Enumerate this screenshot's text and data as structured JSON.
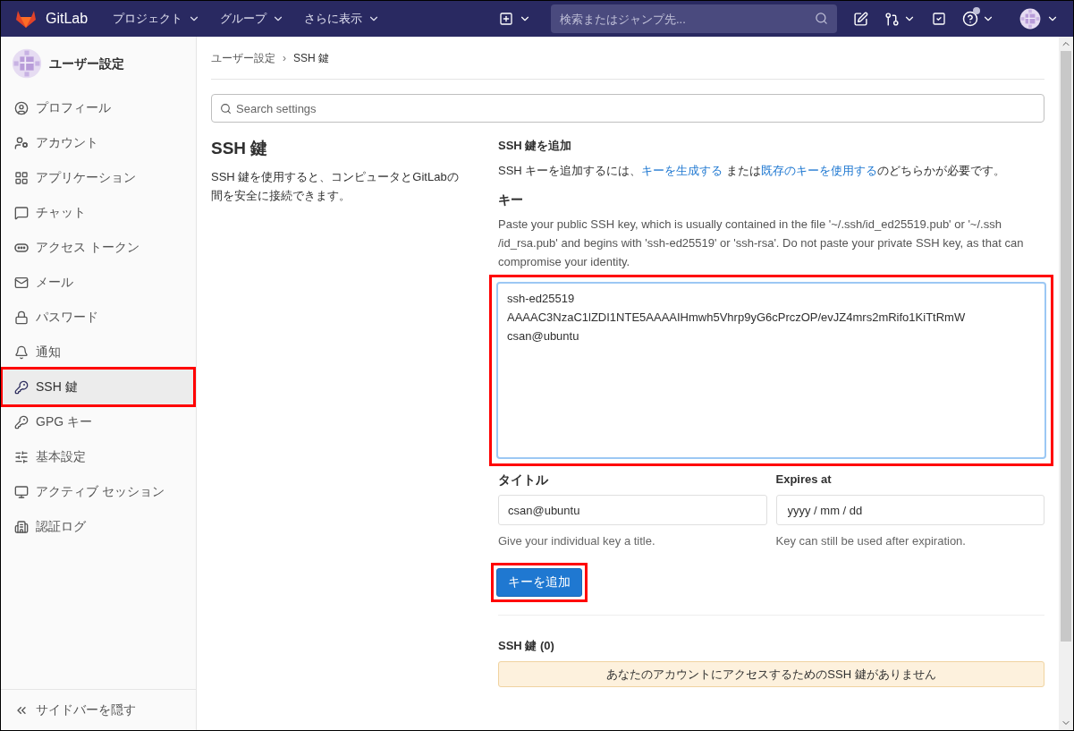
{
  "navbar": {
    "brand": "GitLab",
    "menus": [
      {
        "label": "プロジェクト"
      },
      {
        "label": "グループ"
      },
      {
        "label": "さらに表示"
      }
    ],
    "search": {
      "placeholder": "検索またはジャンプ先..."
    },
    "help_notification": true
  },
  "sidebar": {
    "title": "ユーザー設定",
    "items": [
      {
        "label": "プロフィール",
        "selected": false
      },
      {
        "label": "アカウント",
        "selected": false
      },
      {
        "label": "アプリケーション",
        "selected": false
      },
      {
        "label": "チャット",
        "selected": false
      },
      {
        "label": "アクセス トークン",
        "selected": false
      },
      {
        "label": "メール",
        "selected": false
      },
      {
        "label": "パスワード",
        "selected": false
      },
      {
        "label": "通知",
        "selected": false
      },
      {
        "label": "SSH 鍵",
        "selected": true
      },
      {
        "label": "GPG キー",
        "selected": false
      },
      {
        "label": "基本設定",
        "selected": false
      },
      {
        "label": "アクティブ セッション",
        "selected": false
      },
      {
        "label": "認証ログ",
        "selected": false
      }
    ],
    "collapse": "サイドバーを隠す"
  },
  "breadcrumb": {
    "items": [
      "ユーザー設定",
      "SSH 鍵"
    ],
    "separator": "›"
  },
  "settings_search": {
    "placeholder": "Search settings"
  },
  "section": {
    "title": "SSH 鍵",
    "description": "SSH 鍵を使用すると、コンピュータとGitLabの間を安全に接続できます。"
  },
  "add_key": {
    "heading": "SSH 鍵を追加",
    "intro_before": "SSH キーを追加するには、",
    "link_generate": "キーを生成する",
    "intro_middle": " または",
    "link_existing": "既存のキーを使用する",
    "intro_after": "のどちらかが必要です。",
    "key_label": "キー",
    "key_help": "Paste your public SSH key, which is usually contained in the file '~/.ssh/id_ed25519.pub' or '~/.ssh /id_rsa.pub' and begins with 'ssh-ed25519' or 'ssh-rsa'. Do not paste your private SSH key, as that can compromise your identity.",
    "key_value": "ssh-ed25519\nAAAAC3NzaC1lZDI1NTE5AAAAIHmwh5Vhrp9yG6cPrczOP/evJZ4mrs2mRifo1KiTtRmW\ncsan@ubuntu",
    "title_label": "タイトル",
    "title_value": "csan@ubuntu",
    "title_help": "Give your individual key a title.",
    "expires_label": "Expires at",
    "expires_placeholder": "yyyy / mm / dd",
    "expires_help": "Key can still be used after expiration.",
    "submit": "キーを追加"
  },
  "keys": {
    "heading": "SSH 鍵 (0)",
    "empty": "あなたのアカウントにアクセスするためのSSH 鍵がありません"
  }
}
